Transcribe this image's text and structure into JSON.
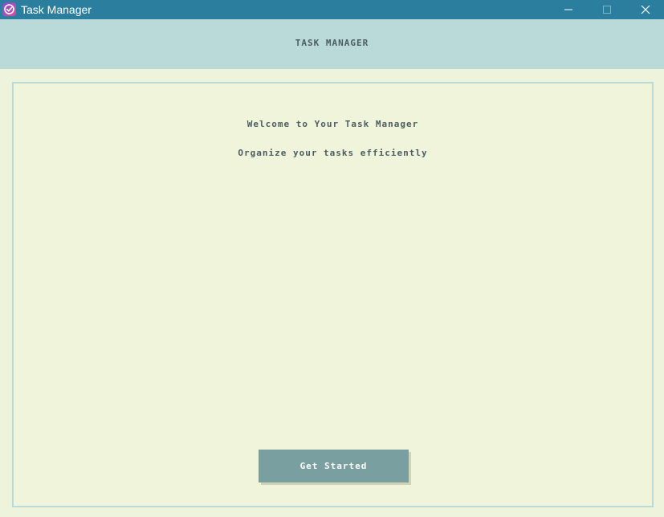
{
  "window": {
    "title": "Task Manager",
    "app_icon": "checkmark-circle-icon",
    "controls": [
      "minimize-icon",
      "maximize-icon",
      "close-icon"
    ]
  },
  "header": {
    "title": "TASK MANAGER"
  },
  "main": {
    "welcome_title": "Welcome to Your Task Manager",
    "subtitle": "Organize your tasks efficiently",
    "start_button_label": "Get Started"
  },
  "colors": {
    "titlebar": "#2b7e9e",
    "header_bg": "#b9dad9",
    "panel_bg": "#eff4db",
    "button_bg": "#7a9fa0",
    "text": "#4d5c62"
  }
}
